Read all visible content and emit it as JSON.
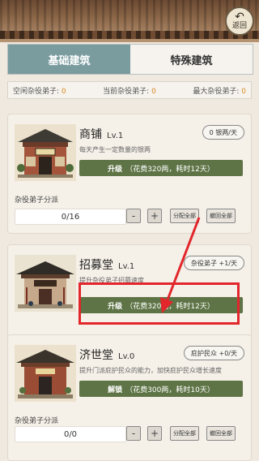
{
  "header": {
    "back_icon": "undo-arrow-icon",
    "back_label": "返回"
  },
  "tabs": [
    {
      "label": "基础建筑",
      "active": true
    },
    {
      "label": "特殊建筑",
      "active": false
    }
  ],
  "stats": {
    "idle_label": "空闲杂役弟子:",
    "idle_value": "0",
    "current_label": "当前杂役弟子:",
    "current_value": "0",
    "max_label": "最大杂役弟子:",
    "max_value": "0"
  },
  "buildings": [
    {
      "name": "商铺",
      "level": "Lv.1",
      "badge": "0 银两/天",
      "desc": "每天产生一定数量的银两",
      "action": "升级",
      "action_detail": "（花费320两，耗时12天）",
      "assign_label": "杂役弟子分派",
      "assign_value": "0/16",
      "minus": "-",
      "plus": "+",
      "assign_all": "分配全部",
      "recall_all": "撤回全部"
    },
    {
      "name": "招募堂",
      "level": "Lv.1",
      "badge": "杂役弟子 +1/天",
      "desc": "提升杂役弟子招募速度",
      "action": "升级",
      "action_detail": "（花费320两，耗时12天）"
    },
    {
      "name": "济世堂",
      "level": "Lv.0",
      "badge": "庇护民众 +0/天",
      "desc": "提升门派庇护民众的能力，加快庇护民众增长速度",
      "action": "解锁",
      "action_detail": "（花费300两，耗时10天）",
      "assign_label": "杂役弟子分派",
      "assign_value": "0/0",
      "minus": "-",
      "plus": "+",
      "assign_all": "分配全部",
      "recall_all": "撤回全部"
    }
  ],
  "colors": {
    "accent_green": "#5e7446",
    "tab_active": "#7b9c9f",
    "annotation_red": "#e2262b"
  }
}
